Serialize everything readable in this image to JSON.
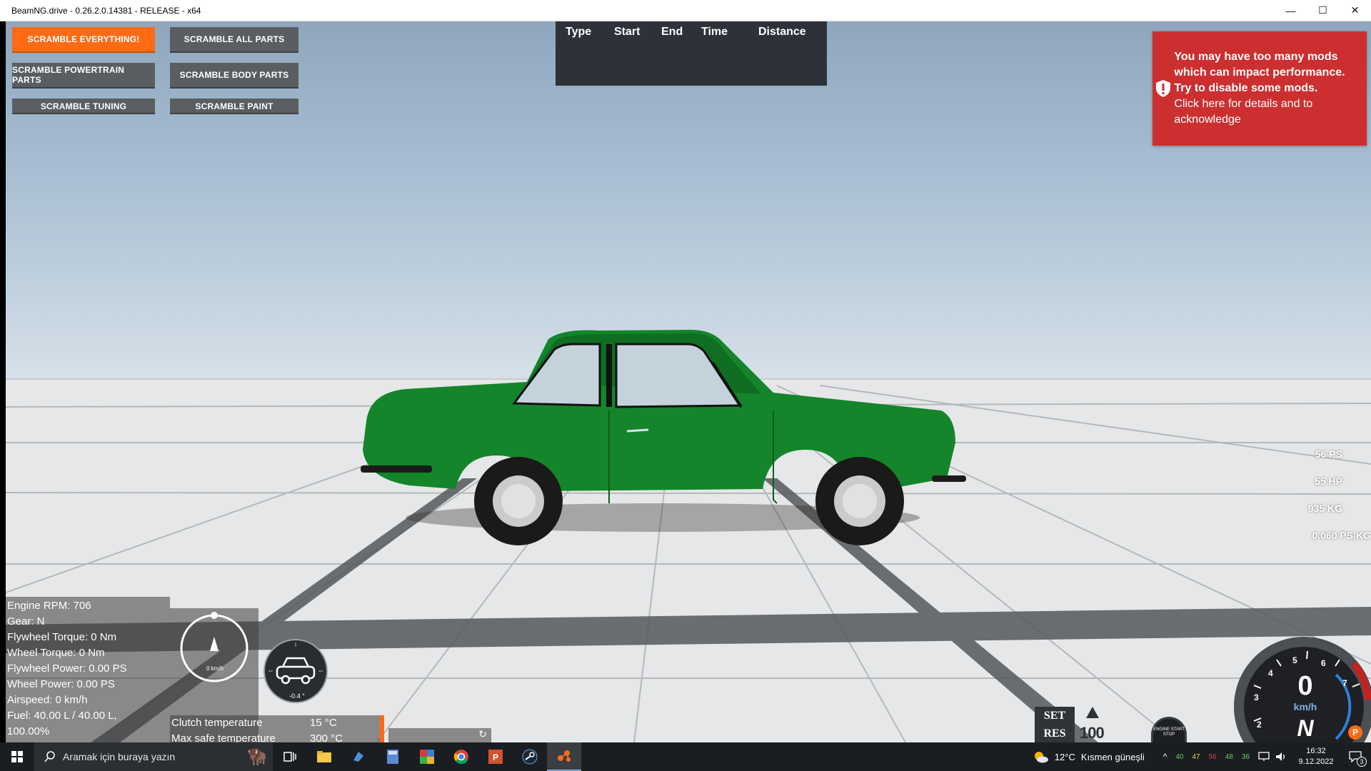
{
  "window": {
    "title": "BeamNG.drive - 0.26.2.0.14381 - RELEASE - x64",
    "minimize_glyph": "—",
    "maximize_glyph": "☐",
    "close_glyph": "✕"
  },
  "scramble": {
    "everything": "SCRAMBLE EVERYTHING!",
    "all_parts": "SCRAMBLE ALL PARTS",
    "powertrain": "SCRAMBLE POWERTRAIN PARTS",
    "body": "SCRAMBLE BODY PARTS",
    "tuning": "SCRAMBLE TUNING",
    "paint": "SCRAMBLE PAINT"
  },
  "lap_table": {
    "headers": [
      "Type",
      "Start",
      "End",
      "Time",
      "Distance"
    ]
  },
  "warning": {
    "bold_text": "You may have too many mods which can impact performance. Try to disable some mods.",
    "normal_text": "Click here for details and to acknowledge",
    "icon": "shield-exclamation-icon",
    "color": "#cc2f2f"
  },
  "vehicle_stats": {
    "ps": "56 PS",
    "hp": "55 HP",
    "weight": "935 KG",
    "ratio": "0.060 PS/KG"
  },
  "debug": {
    "lines": [
      "Engine RPM: 706",
      "Gear: N",
      "Flywheel Torque: 0 Nm",
      "Wheel Torque: 0 Nm",
      "Flywheel Power: 0.00 PS",
      "Wheel Power: 0.00 PS",
      "Airspeed: 0 km/h",
      "Fuel: 40.00 L / 40.00 L,",
      "100.00%"
    ],
    "compass_speed": "0 km/h",
    "inclinometer_value": "-0.4 °"
  },
  "clutch": {
    "label": "Clutch temperature",
    "value": "15 °C",
    "max_label": "Max safe temperature",
    "max_value": "300 °C"
  },
  "cruise": {
    "set": "SET",
    "res": "RES",
    "speed": "100"
  },
  "dash": {
    "speed": "0",
    "unit": "km/h",
    "gear": "N",
    "tach_labels": [
      "2",
      "3",
      "4",
      "5",
      "6",
      "7"
    ],
    "engine_button": "ENGINE START STOP",
    "parking": "P"
  },
  "taskbar": {
    "search_placeholder": "Aramak için buraya yazın",
    "weather_temp": "12°C",
    "weather_desc": "Kısmen güneşli",
    "tray_numbers": [
      "40",
      "47",
      "56",
      "48",
      "36"
    ],
    "time": "16:32",
    "date": "9.12.2022",
    "notifications": "3"
  },
  "colors": {
    "accent_orange": "#ff6a14",
    "button_gray": "#5a5e62",
    "car_green": "#14852a",
    "taskbar": "#1a1d21"
  }
}
